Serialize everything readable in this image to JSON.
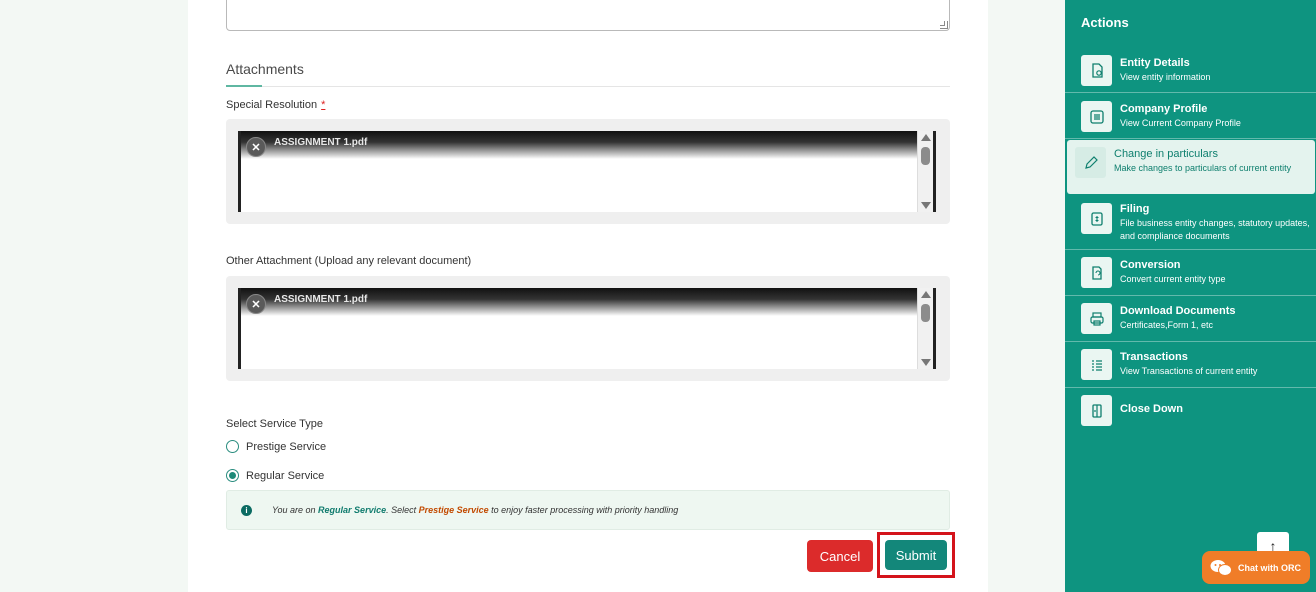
{
  "form": {
    "section_title": "Attachments",
    "special_resolution": {
      "label": "Special Resolution",
      "required_mark": "*",
      "file_name": "ASSIGNMENT 1.pdf"
    },
    "other_attachment": {
      "label": "Other Attachment (Upload any relevant document)",
      "file_name": "ASSIGNMENT 1.pdf"
    },
    "service_type": {
      "label": "Select Service Type",
      "options": [
        {
          "label": "Prestige Service",
          "selected": false
        },
        {
          "label": "Regular Service",
          "selected": true
        }
      ]
    },
    "info": {
      "part1": "You are on ",
      "current": "Regular Service",
      "part2": ". Select ",
      "upgrade": "Prestige Service",
      "part3": " to enjoy faster processing with priority handling"
    },
    "cancel_label": "Cancel",
    "submit_label": "Submit"
  },
  "sidebar": {
    "title": "Actions",
    "items": [
      {
        "title": "Entity Details",
        "desc": "View entity information",
        "icon": "document-search-icon"
      },
      {
        "title": "Company Profile",
        "desc": "View Current Company Profile",
        "icon": "list-icon"
      },
      {
        "title": "Change in particulars",
        "desc": "Make changes to particulars of current entity",
        "icon": "pencil-icon",
        "active": true
      },
      {
        "title": "Filing",
        "desc": "File business entity changes, statutory updates, and compliance documents",
        "icon": "filing-icon"
      },
      {
        "title": "Conversion",
        "desc": "Convert current entity type",
        "icon": "conversion-icon"
      },
      {
        "title": "Download Documents",
        "desc": "Certificates,Form 1, etc",
        "icon": "printer-icon"
      },
      {
        "title": "Transactions",
        "desc": "View Transactions of current entity",
        "icon": "transactions-icon"
      },
      {
        "title": "Close Down",
        "desc": "",
        "icon": "close-down-icon"
      }
    ]
  },
  "chat": {
    "label": "Chat with ORC"
  },
  "colors": {
    "teal": "#0e9480",
    "cancel": "#dc2b2b",
    "submit": "#13877a",
    "chat": "#f07d28",
    "highlight": "#d4131b"
  }
}
